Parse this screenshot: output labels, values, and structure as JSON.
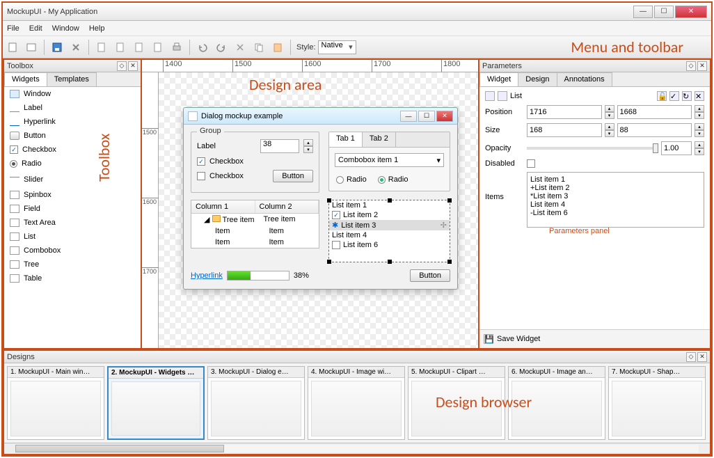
{
  "titlebar": {
    "title": "MockupUI - My Application"
  },
  "menu": {
    "file": "File",
    "edit": "Edit",
    "window": "Window",
    "help": "Help"
  },
  "toolbar": {
    "buttons": [
      "new",
      "open",
      "save",
      "delete",
      "copy",
      "cut",
      "paste",
      "duplicate",
      "print",
      "undo",
      "redo",
      "cut2",
      "copy2",
      "paste2"
    ],
    "style_label": "Style:",
    "style_value": "Native"
  },
  "annotations": {
    "menu_toolbar": "Menu and toolbar",
    "toolbox": "Toolbox",
    "design_area": "Design area",
    "parameters": "Parameters panel",
    "design_browser": "Design browser"
  },
  "toolbox": {
    "title": "Toolbox",
    "tabs": {
      "widgets": "Widgets",
      "templates": "Templates"
    },
    "items": [
      "Window",
      "Label",
      "Hyperlink",
      "Button",
      "Checkbox",
      "Radio",
      "Slider",
      "Spinbox",
      "Field",
      "Text Area",
      "List",
      "Combobox",
      "Tree",
      "Table"
    ]
  },
  "ruler": {
    "h": [
      "1400",
      "1500",
      "1600",
      "1700",
      "1800"
    ],
    "v": [
      "1500",
      "1600",
      "1700"
    ]
  },
  "dialog": {
    "title": "Dialog mockup example",
    "group_title": "Group",
    "label": "Label",
    "label_value": "38",
    "checkbox1": "Checkbox",
    "checkbox2": "Checkbox",
    "button": "Button",
    "tab1": "Tab 1",
    "tab2": "Tab 2",
    "combo": "Combobox item 1",
    "radio": "Radio",
    "col1": "Column 1",
    "col2": "Column 2",
    "tree_root": "Tree item",
    "tree_val": "Tree item",
    "item": "Item",
    "list": [
      "List item 1",
      "List item 2",
      "List item 3",
      "List item 4",
      "List item 6"
    ],
    "hyperlink": "Hyperlink",
    "progress": "38%",
    "button2": "Button"
  },
  "parameters": {
    "title": "Parameters",
    "tabs": {
      "widget": "Widget",
      "design": "Design",
      "annotations": "Annotations"
    },
    "widget_label": "List",
    "position_label": "Position",
    "pos_x": "1716",
    "pos_y": "1668",
    "size_label": "Size",
    "size_w": "168",
    "size_h": "88",
    "opacity_label": "Opacity",
    "opacity": "1.00",
    "disabled_label": "Disabled",
    "items_label": "Items",
    "items_text": "List item 1\n +List item 2\n *List item 3\n List item 4\n -List item 6",
    "save_widget": "Save Widget"
  },
  "designs": {
    "title": "Designs",
    "thumbs": [
      "1. MockupUI - Main win…",
      "2. MockupUI - Widgets …",
      "3. MockupUI - Dialog e…",
      "4. MockupUI - Image wi…",
      "5. MockupUI - Clipart …",
      "6. MockupUI - Image an…",
      "7. MockupUI - Shap…"
    ],
    "selected": 1
  }
}
